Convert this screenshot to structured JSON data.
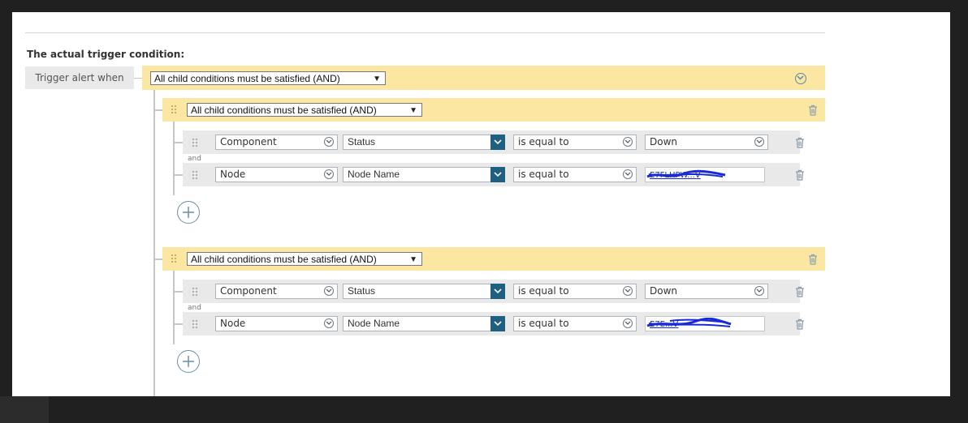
{
  "section_title": "The actual trigger condition:",
  "trigger_label": "Trigger alert when",
  "root_group": {
    "operator": "All child conditions must be satisfied (AND)"
  },
  "groups": [
    {
      "operator": "All child conditions must be satisfied (AND)",
      "join_word": "and",
      "conditions": [
        {
          "object": "Component",
          "property": "Status",
          "operator": "is equal to",
          "value": "Down"
        },
        {
          "object": "Node",
          "property": "Node Name",
          "operator": "is equal to",
          "value": "E7FLHPW...V",
          "value_redacted": true
        }
      ]
    },
    {
      "operator": "All child conditions must be satisfied (AND)",
      "join_word": "and",
      "conditions": [
        {
          "object": "Component",
          "property": "Status",
          "operator": "is equal to",
          "value": "Down"
        },
        {
          "object": "Node",
          "property": "Node Name",
          "operator": "is equal to",
          "value": "E7E...V",
          "value_redacted": true
        }
      ]
    }
  ],
  "colors": {
    "group_bar": "#fbe6a2",
    "row_bg": "#e9e9e9",
    "dropdown_button": "#1f5f7f",
    "icon_accent": "#5d8aa8",
    "redaction_ink": "#1a2bd6"
  },
  "icons": [
    "chevron-down-circle-icon",
    "trash-icon",
    "drag-handle-icon",
    "plus-circle-icon",
    "chevron-down-icon"
  ]
}
